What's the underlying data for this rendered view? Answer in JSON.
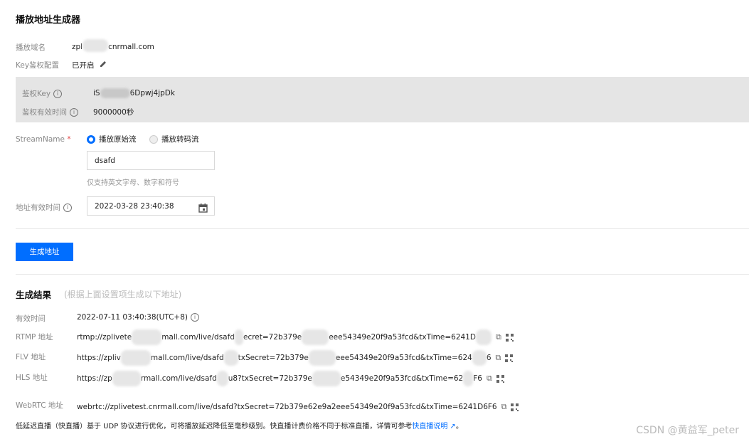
{
  "title": "播放地址生成器",
  "domain": {
    "label": "播放域名",
    "value_prefix": "zpl",
    "value_suffix": "cnrmall.com"
  },
  "key_auth": {
    "label": "Key鉴权配置",
    "value": "已开启"
  },
  "auth_key": {
    "label": "鉴权Key",
    "value_prefix": "iS",
    "value_suffix": "6Dpwj4jpDk"
  },
  "auth_valid": {
    "label": "鉴权有效时间",
    "value": "9000000秒"
  },
  "stream": {
    "label": "StreamName",
    "required_mark": "*",
    "option_original": "播放原始流",
    "option_transcode": "播放转码流",
    "input_value": "dsafd",
    "hint": "仅支持英文字母、数字和符号"
  },
  "expire": {
    "label": "地址有效时间",
    "value": "2022-03-28 23:40:38"
  },
  "generate_button": "生成地址",
  "result": {
    "title": "生成结果",
    "subtitle": "(根据上面设置项生成以下地址)",
    "valid_label": "有效时间",
    "valid_value": "2022-07-11 03:40:38(UTC+8)",
    "rows": [
      {
        "label": "RTMP 地址",
        "a": "rtmp://zplivete",
        "b": "mall.com/live/dsafd",
        "c": "ecret=72b379e",
        "d": "eee54349e20f9a53fcd&txTime=6241D"
      },
      {
        "label": "FLV 地址",
        "a": "https://zpliv",
        "b": "mall.com/live/dsafd",
        "c": "txSecret=72b379e",
        "d": "eee54349e20f9a53fcd&txTime=624",
        "e": "6"
      },
      {
        "label": "HLS 地址",
        "a": "https://zp",
        "b": "rmall.com/live/dsafd",
        "c": "u8?txSecret=72b379e",
        "d": "e54349e20f9a53fcd&txTime=62",
        "e": "F6"
      }
    ],
    "webrtc_label": "WebRTC 地址",
    "webrtc_value": "webrtc://zplivetest.cnrmall.com/live/dsafd?txSecret=72b379e62e9a2eee54349e20f9a53fcd&txTime=6241D6F6"
  },
  "footer": {
    "text": "低延迟直播（快直播）基于 UDP 协议进行优化，可将播放延迟降低至毫秒级别。快直播计费价格不同于标准直播，详情可参考",
    "link": "快直播说明",
    "end": "。"
  },
  "watermark": "CSDN @黄益军_peter"
}
